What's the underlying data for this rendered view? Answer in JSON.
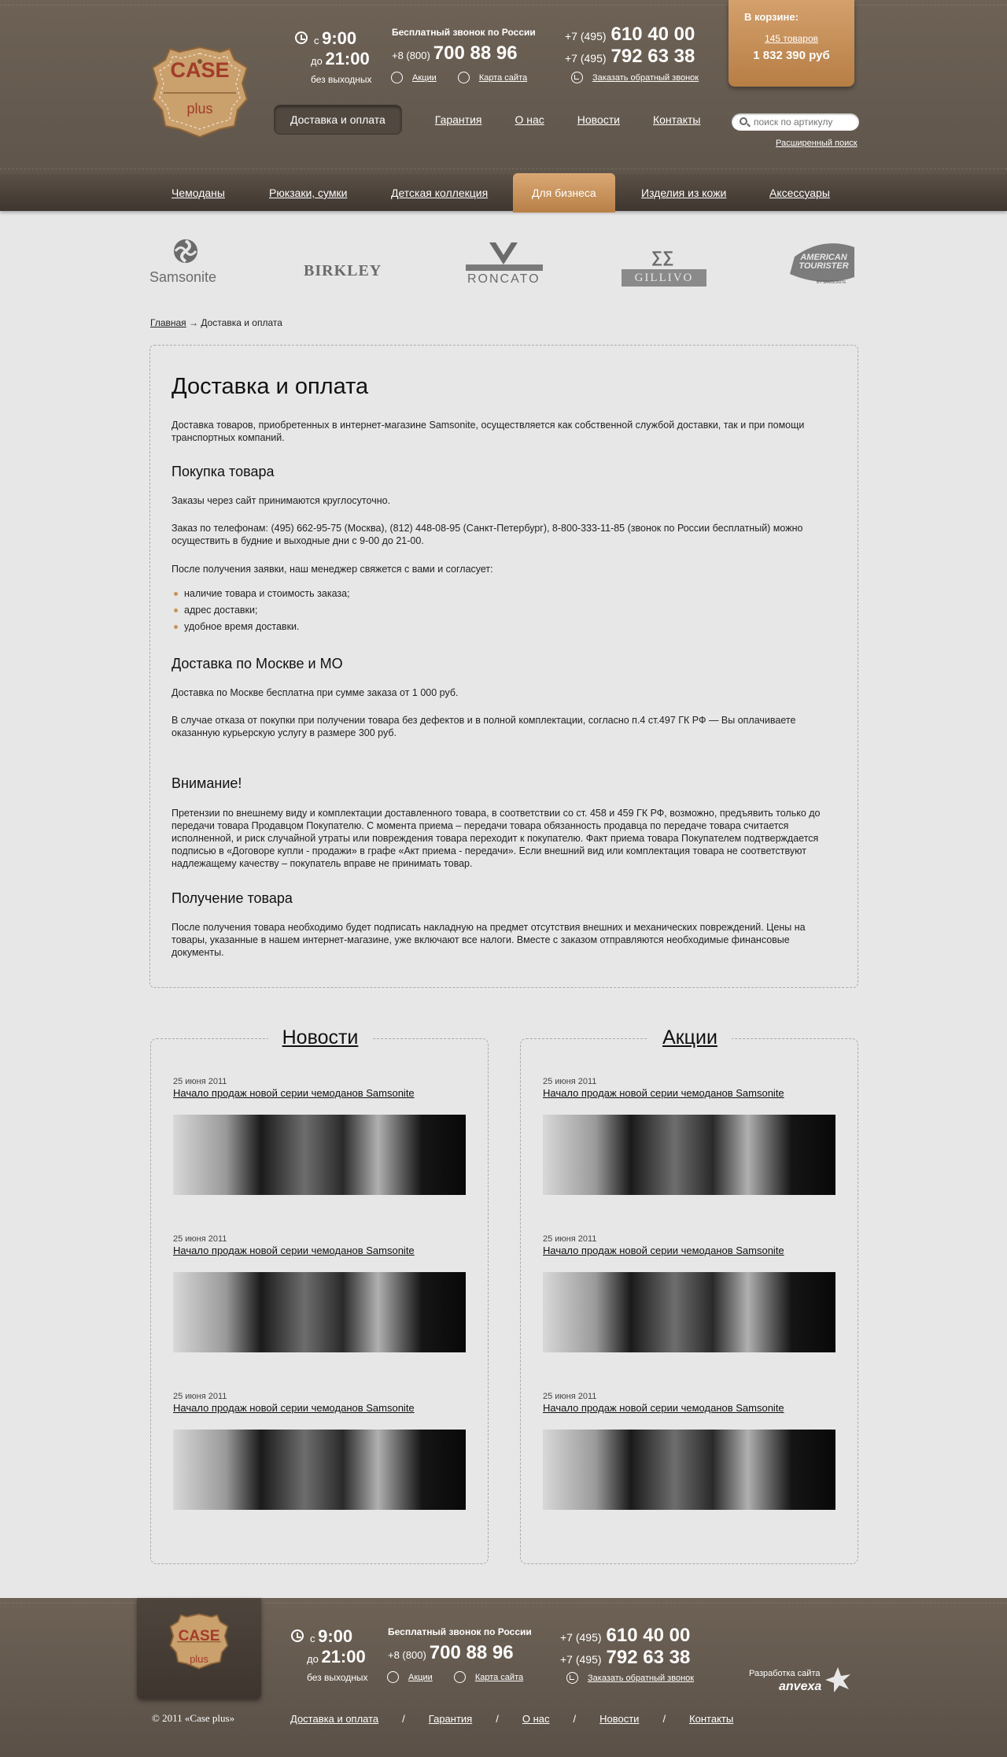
{
  "header": {
    "logo": {
      "line1": "CASE",
      "line2": "plus"
    },
    "hours": {
      "from_prefix": "с",
      "from": "9:00",
      "to_prefix": "до",
      "to": "21:00",
      "note": "без выходных"
    },
    "free_call": {
      "title": "Бесплатный звонок по России",
      "code": "+8 (800)",
      "number": "700 88 96"
    },
    "links": {
      "promo": "Акции",
      "sitemap": "Карта сайта",
      "callback": "Заказать обратный звонок"
    },
    "phones": [
      {
        "code": "+7 (495)",
        "number": "610 40 00"
      },
      {
        "code": "+7 (495)",
        "number": "792 63 38"
      }
    ],
    "cart": {
      "title": "В корзине:",
      "count": "145 товаров",
      "sum": "1 832 390 руб"
    },
    "nav": [
      "Доставка и оплата",
      "Гарантия",
      "О нас",
      "Новости",
      "Контакты"
    ],
    "search_placeholder": "поиск по артикулу",
    "advanced_search": "Расширенный поиск"
  },
  "categories": [
    "Чемоданы",
    "Рюкзаки, сумки",
    "Детская коллекция",
    "Для бизнеса",
    "Изделия из кожи",
    "Аксессуары"
  ],
  "brands": [
    "Samsonite",
    "BIRKLEY",
    "RONCATO",
    "GILLIVO",
    "AMERICAN TOURISTER",
    "BY SAMSONITE"
  ],
  "breadcrumb": {
    "home": "Главная",
    "arrow": "→",
    "current": "Доставка и оплата"
  },
  "article": {
    "title": "Доставка и оплата",
    "intro": "Доставка товаров, приобретенных в интернет-магазине Samsonite, осуществляется как собственной службой доставки, так и при помощи транспортных компаний.",
    "purchase_title": "Покупка товара",
    "purchase_p1": "Заказы через сайт принимаются круглосуточно.",
    "purchase_p2": "Заказ по телефонам: (495) 662-95-75 (Москва), (812) 448-08-95 (Санкт-Петербург), 8-800-333-11-85 (звонок по России бесплатный) можно осуществить в будние и выходные дни с 9-00 до 21-00.",
    "purchase_p3": "После получения заявки, наш менеджер свяжется с вами и согласует:",
    "purchase_list": [
      "наличие товара и стоимость заказа;",
      "адрес доставки;",
      "удобное время доставки."
    ],
    "moscow_title": "Доставка по Москве и МО",
    "moscow_p1": "Доставка по Москве бесплатна при сумме заказа от 1 000 руб.",
    "moscow_p2": "В случае отказа от покупки при получении товара без дефектов и в полной комплектации, согласно п.4 ст.497 ГК РФ — Вы оплачиваете оказанную курьерскую услугу в размере 300 руб.",
    "attention_title": "Внимание!",
    "attention_p": "Претензии по внешнему виду и комплектации доставленного товара, в соответствии со ст. 458 и 459 ГК РФ, возможно, предъявить только до передачи товара Продавцом Покупателю. С момента приема – передачи товара обязанность продавца по передаче товара считается исполненной, и риск случайной утраты или повреждения товара переходит к покупателю. Факт приема товара Покупателем подтверждается подписью в «Договоре купли - продажи» в графе «Акт приема - передачи». Если внешний вид или комплектация товара не соответствуют надлежащему качеству – покупатель вправе не принимать товар.",
    "receive_title": "Получение товара",
    "receive_p": "После получения товара необходимо будет подписать накладную на предмет отсутствия внешних и механических повреждений. Цены на товары, указанные в нашем интернет-магазине, уже включают все налоги. Вместе с заказом отправляются необходимые финансовые документы."
  },
  "news": {
    "title": "Новости",
    "items": [
      {
        "date": "25 июня 2011",
        "title": "Начало продаж новой серии чемоданов Samsonite"
      },
      {
        "date": "25 июня 2011",
        "title": "Начало продаж новой серии чемоданов Samsonite"
      },
      {
        "date": "25 июня 2011",
        "title": "Начало продаж новой серии чемоданов Samsonite"
      }
    ]
  },
  "promos": {
    "title": "Акции",
    "items": [
      {
        "date": "25 июня 2011",
        "title": "Начало продаж новой серии чемоданов Samsonite"
      },
      {
        "date": "25 июня 2011",
        "title": "Начало продаж новой серии чемоданов Samsonite"
      },
      {
        "date": "25 июня 2011",
        "title": "Начало продаж новой серии чемоданов Samsonite"
      }
    ]
  },
  "footer": {
    "copyright": "© 2011 «Case plus»",
    "nav": [
      "Доставка и оплата",
      "Гарантия",
      "О нас",
      "Новости",
      "Контакты"
    ],
    "separator": "/",
    "dev_label": "Разработка сайта",
    "dev_name": "anvexa"
  },
  "colors": {
    "header_brown": "#6e6256",
    "accent_orange": "#c98f55",
    "page_bg": "#e7e7e7"
  }
}
